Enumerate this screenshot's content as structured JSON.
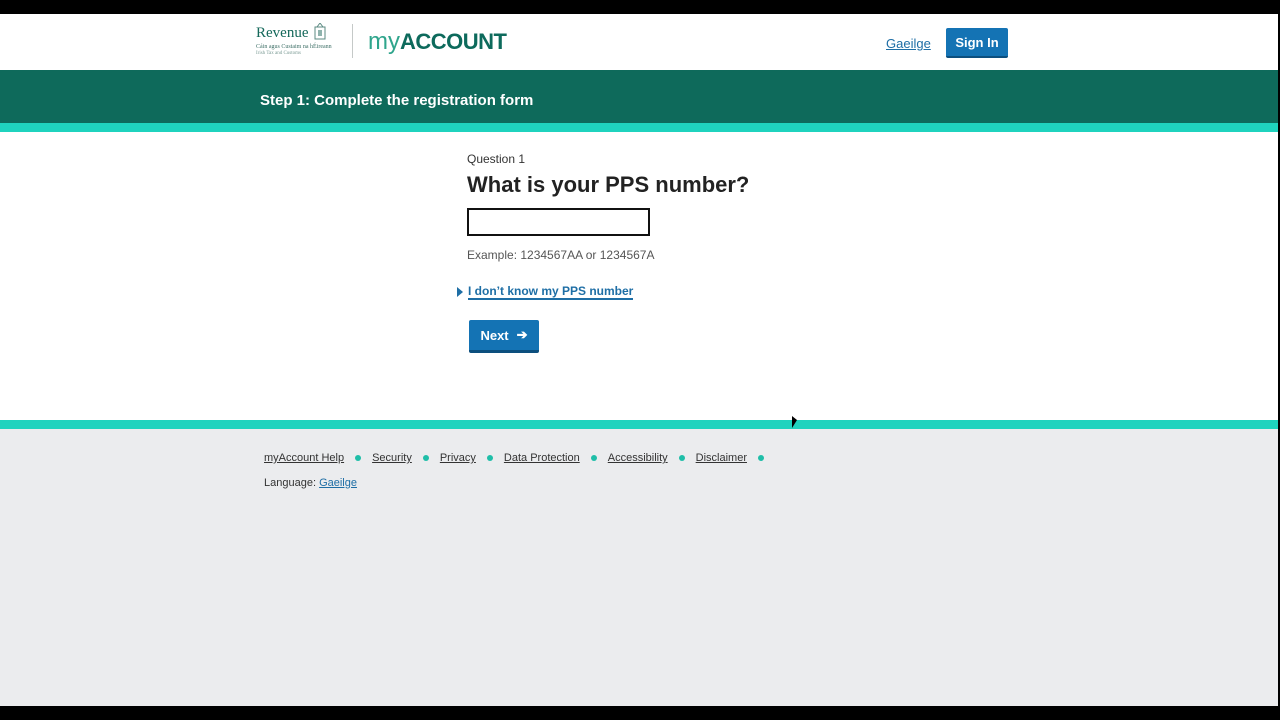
{
  "header": {
    "logo_revenue": "Revenue",
    "logo_sub_irish": "Cáin agus Custaim na hÉireann",
    "logo_sub_english": "Irish Tax and Customs",
    "app_name_prefix": "my",
    "app_name_main": "Account",
    "language_link": "Gaeilge",
    "sign_in_label": "Sign In"
  },
  "banner": {
    "title": "Step 1: Complete the registration form"
  },
  "form": {
    "question_label": "Question 1",
    "question_title": "What is your PPS number?",
    "pps_value": "",
    "hint": "Example: 1234567AA or 1234567A",
    "details_label": "I don’t know my PPS number",
    "next_label": "Next",
    "next_arrow": "➔"
  },
  "footer": {
    "links": [
      "myAccount Help",
      "Security",
      "Privacy",
      "Data Protection",
      "Accessibility",
      "Disclaimer"
    ],
    "language_prefix": "Language:",
    "language_link": "Gaeilge"
  },
  "colors": {
    "brand_green": "#0e6a5b",
    "accent_teal": "#1fd3be",
    "button_blue": "#1473b4",
    "link_blue": "#1e6ea5"
  },
  "icons": [
    "crest-icon",
    "arrow-right-icon",
    "caret-right-icon",
    "bullet-dot-icon"
  ]
}
